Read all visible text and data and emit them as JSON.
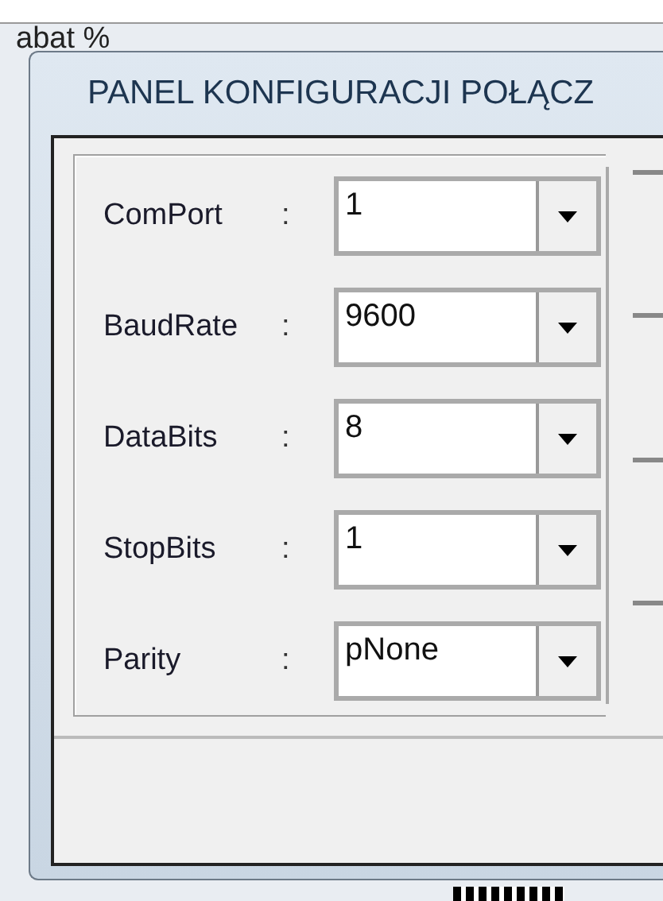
{
  "background_window": {
    "label": "abat %"
  },
  "dialog": {
    "title": "PANEL KONFIGURACJI POŁĄCZ"
  },
  "settings": [
    {
      "label": "ComPort",
      "separator": ":",
      "value": "1"
    },
    {
      "label": "BaudRate",
      "separator": ":",
      "value": "9600"
    },
    {
      "label": "DataBits",
      "separator": ":",
      "value": "8"
    },
    {
      "label": "StopBits",
      "separator": ":",
      "value": "1"
    },
    {
      "label": "Parity",
      "separator": ":",
      "value": "pNone"
    }
  ]
}
